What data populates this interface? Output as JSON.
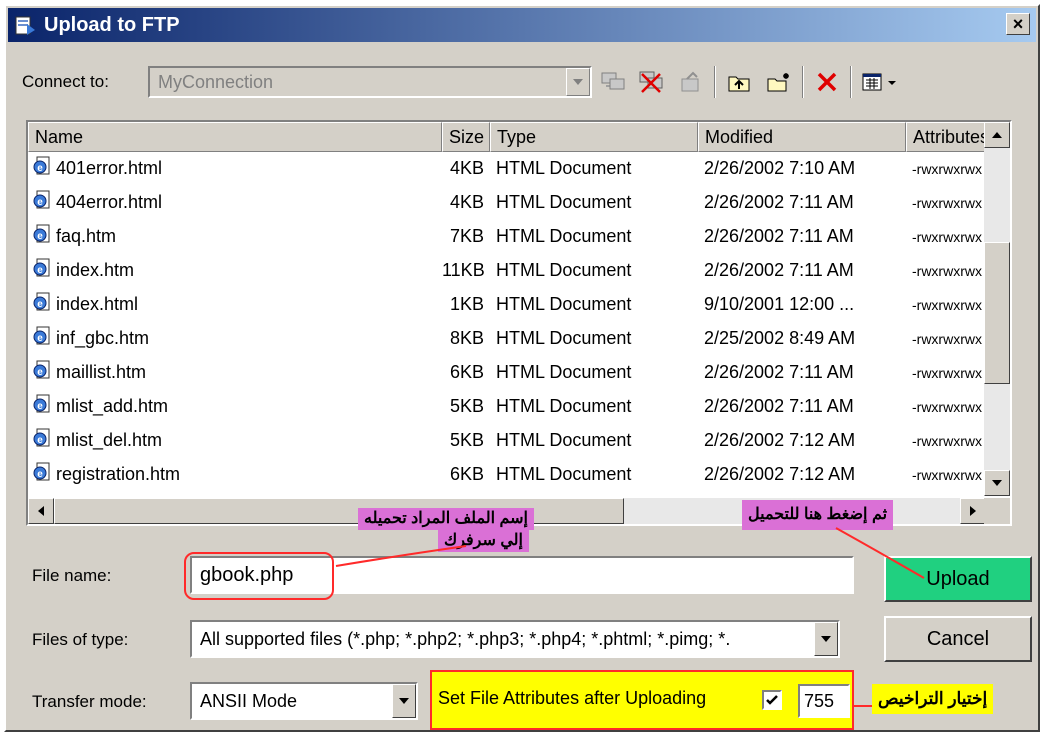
{
  "window": {
    "title": "Upload to FTP",
    "close": "×"
  },
  "toolbar": {
    "connect_label": "Connect to:",
    "connection": "MyConnection",
    "icons": [
      "connect-icon",
      "disconnect-icon",
      "properties-icon",
      "up-folder-icon",
      "new-folder-icon",
      "delete-icon",
      "view-menu-icon"
    ]
  },
  "list": {
    "headers": {
      "name": "Name",
      "size": "Size",
      "type": "Type",
      "modified": "Modified",
      "attributes": "Attributes"
    },
    "rows": [
      {
        "name": "401error.html",
        "size": "4KB",
        "type": "HTML Document",
        "modified": "2/26/2002 7:10 AM",
        "attributes": "-rwxrwxrwx"
      },
      {
        "name": "404error.html",
        "size": "4KB",
        "type": "HTML Document",
        "modified": "2/26/2002 7:11 AM",
        "attributes": "-rwxrwxrwx"
      },
      {
        "name": "faq.htm",
        "size": "7KB",
        "type": "HTML Document",
        "modified": "2/26/2002 7:11 AM",
        "attributes": "-rwxrwxrwx"
      },
      {
        "name": "index.htm",
        "size": "11KB",
        "type": "HTML Document",
        "modified": "2/26/2002 7:11 AM",
        "attributes": "-rwxrwxrwx"
      },
      {
        "name": "index.html",
        "size": "1KB",
        "type": "HTML Document",
        "modified": "9/10/2001 12:00 ...",
        "attributes": "-rwxrwxrwx"
      },
      {
        "name": "inf_gbc.htm",
        "size": "8KB",
        "type": "HTML Document",
        "modified": "2/25/2002 8:49 AM",
        "attributes": "-rwxrwxrwx"
      },
      {
        "name": "maillist.htm",
        "size": "6KB",
        "type": "HTML Document",
        "modified": "2/26/2002 7:11 AM",
        "attributes": "-rwxrwxrwx"
      },
      {
        "name": "mlist_add.htm",
        "size": "5KB",
        "type": "HTML Document",
        "modified": "2/26/2002 7:11 AM",
        "attributes": "-rwxrwxrwx"
      },
      {
        "name": "mlist_del.htm",
        "size": "5KB",
        "type": "HTML Document",
        "modified": "2/26/2002 7:12 AM",
        "attributes": "-rwxrwxrwx"
      },
      {
        "name": "registration.htm",
        "size": "6KB",
        "type": "HTML Document",
        "modified": "2/26/2002 7:12 AM",
        "attributes": "-rwxrwxrwx"
      }
    ]
  },
  "form": {
    "file_name_label": "File name:",
    "file_name_value": "gbook.php",
    "files_type_label": "Files of type:",
    "files_type_value": "All supported files (*.php; *.php2; *.php3; *.php4; *.phtml; *.pimg; *.",
    "transfer_label": "Transfer mode:",
    "transfer_value": "ANSII Mode",
    "set_attr_label": "Set File Attributes after Uploading",
    "set_attr_checked": true,
    "attr_value": "755",
    "upload_button": "Upload",
    "cancel_button": "Cancel"
  },
  "annotations": {
    "filename_note_line1": "إسم الملف المراد تحميله",
    "filename_note_line2": "إلي سرفرك",
    "upload_note": "ثم إضغط هنا للتحميل",
    "attributes_note": "إختيار التراخيص"
  },
  "colors": {
    "title_start": "#0a246a",
    "title_end": "#a6caf0",
    "upload_button": "#20d080",
    "annotation_pink": "#da70d6",
    "annotation_yellow": "#ffff00",
    "annotation_red": "#ff2a2a"
  }
}
